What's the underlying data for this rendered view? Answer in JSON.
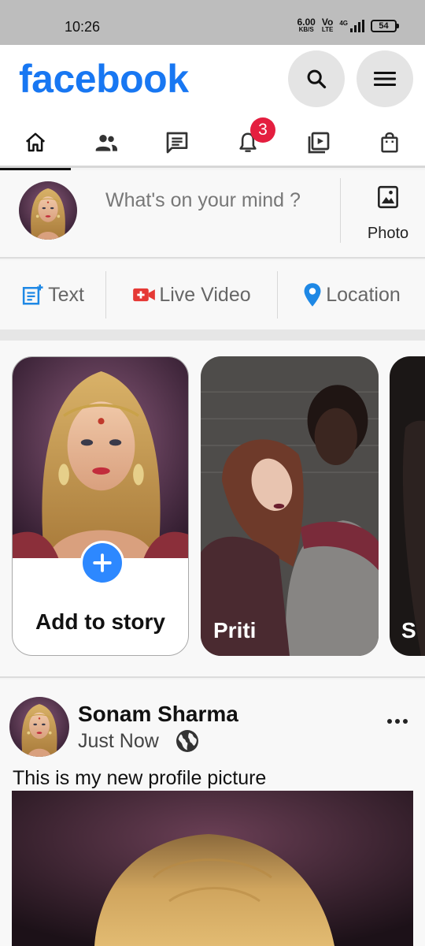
{
  "status_bar": {
    "time": "10:26",
    "net_speed": "6.00",
    "net_unit": "KB/S",
    "vo_top": "Vo",
    "vo_bottom": "LTE",
    "network_type": "4G",
    "battery": "54"
  },
  "header": {
    "logo": "facebook",
    "search_icon": "search-icon",
    "menu_icon": "menu-icon"
  },
  "tabs": [
    {
      "icon": "home-icon",
      "active": true
    },
    {
      "icon": "friends-icon",
      "active": false
    },
    {
      "icon": "messages-icon",
      "active": false
    },
    {
      "icon": "bell-icon",
      "active": false,
      "badge": "3"
    },
    {
      "icon": "watch-icon",
      "active": false
    },
    {
      "icon": "marketplace-icon",
      "active": false
    }
  ],
  "composer": {
    "placeholder": "What's on your mind ?",
    "photo_label": "Photo"
  },
  "actions": {
    "text_label": "Text",
    "live_label": "Live Video",
    "location_label": "Location"
  },
  "stories": {
    "add_label": "Add to story",
    "friend_name": "Priti",
    "next_name": "S"
  },
  "post": {
    "author": "Sonam Sharma",
    "time": "Just Now",
    "caption": "This is my new profile picture"
  },
  "colors": {
    "brand": "#1877f2",
    "badge": "#e41e3f",
    "add_button": "#2d88ff",
    "text_icon": "#1e88e5",
    "live_icon": "#e53935",
    "location_icon": "#1e88e5"
  }
}
